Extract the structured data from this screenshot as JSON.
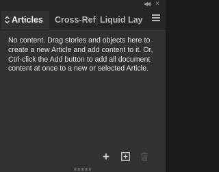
{
  "panel": {
    "tabs": [
      {
        "label": "Articles",
        "active": true
      },
      {
        "label": "Cross-Refe",
        "active": false
      },
      {
        "label": "Liquid Lay",
        "active": false
      }
    ],
    "message": "No content. Drag stories and objects here to create a new Article and add content to it. Or, Ctrl-click the Add button to add all document content at once to a new or selected Article.",
    "icons": {
      "collapse": "collapse-icon",
      "close": "close-icon",
      "menu": "panel-menu-icon",
      "add": "add-icon",
      "new_article": "new-article-icon",
      "delete": "trash-icon",
      "sort": "sort-updown-icon"
    },
    "colors": {
      "panel_bg": "#323232",
      "tabbar_bg": "#262626",
      "text": "#e6e6e6",
      "disabled_icon": "#5a5a5a"
    }
  }
}
